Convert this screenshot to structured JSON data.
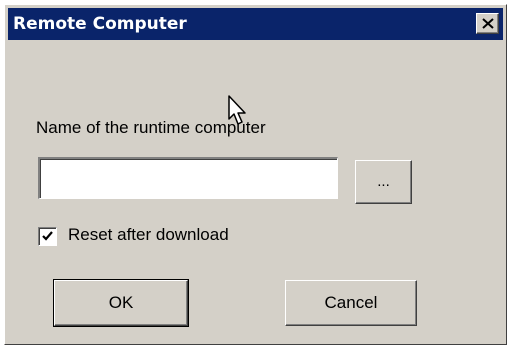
{
  "window": {
    "title": "Remote Computer",
    "close_icon": "close-icon"
  },
  "form": {
    "name_label": "Name of the runtime computer",
    "name_value": "",
    "browse_label": "...",
    "reset_label": "Reset after download",
    "reset_checked": true
  },
  "buttons": {
    "ok_label": "OK",
    "cancel_label": "Cancel"
  },
  "overlay": {
    "cursor_icon": "mouse-pointer-icon"
  },
  "colors": {
    "titlebar": "#0a246a",
    "dialog_face": "#d4d0c8"
  }
}
